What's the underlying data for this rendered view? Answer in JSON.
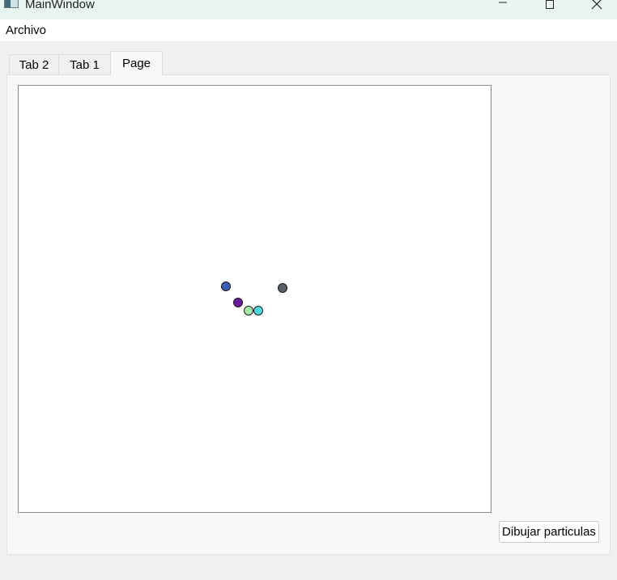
{
  "window": {
    "title": "MainWindow"
  },
  "menu": {
    "items": [
      {
        "label": "Archivo"
      }
    ]
  },
  "tabs": [
    {
      "label": "Tab 2",
      "active": false
    },
    {
      "label": "Tab 1",
      "active": false
    },
    {
      "label": "Page",
      "active": true
    }
  ],
  "page": {
    "canvas": {
      "particles": [
        {
          "color": "#3b5fb5"
        },
        {
          "color": "#5a5e66"
        },
        {
          "color": "#6a1b9a"
        },
        {
          "color": "#a5e8a8"
        },
        {
          "color": "#4fd8dc"
        }
      ]
    },
    "draw_button_label": "Dibujar particulas"
  }
}
